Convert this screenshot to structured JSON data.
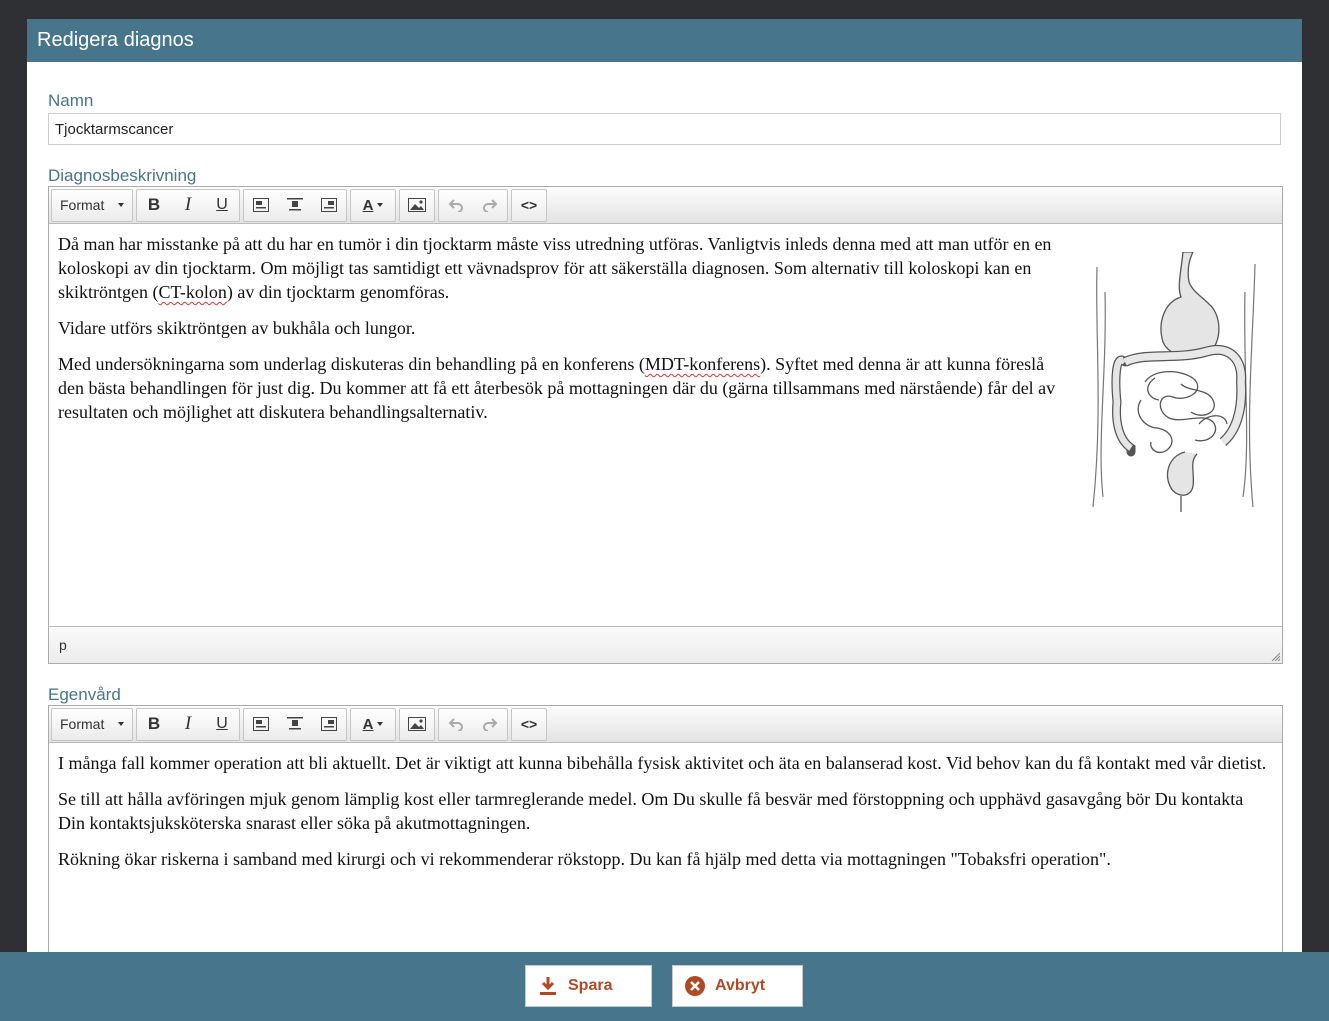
{
  "dialog": {
    "title": "Redigera diagnos"
  },
  "name_field": {
    "label": "Namn",
    "value": "Tjocktarmscancer"
  },
  "toolbar": {
    "format_label": "Format",
    "bold_label": "B",
    "italic_label": "I",
    "underline_label": "U",
    "text_color_label": "A",
    "source_label": "<>"
  },
  "description": {
    "label": "Diagnosbeskrivning",
    "p1_a": "Då man har misstanke på att du har en tumör i din tjocktarm måste viss utredning utföras. Vanligtvis inleds denna med att man utför en en koloskopi av din tjocktarm. Om möjligt tas samtidigt ett vävnadsprov för att säkerställa diagnosen. Som alternativ till koloskopi kan en skiktröntgen (",
    "p1_b": "CT-kolon",
    "p1_c": ") av din tjocktarm genomföras.",
    "p2": "Vidare utförs skiktröntgen av bukhåla och lungor.",
    "p3_a": "Med undersökningarna som underlag diskuteras din behandling på en konferens (",
    "p3_b": "MDT-konferens",
    "p3_c": "). Syftet med denna är att kunna föreslå den bästa behandlingen för just dig. Du kommer att få ett återbesök på mottagningen där du (gärna tillsammans med närstående) får del av resultaten och möjlighet att diskutera behandlingsalternativ.",
    "status_path": "p",
    "illustration": "digestive-system-illustration"
  },
  "selfcare": {
    "label": "Egenvård",
    "p1": "I många fall kommer operation att bli aktuellt. Det är viktigt att kunna bibehålla fysisk aktivitet och äta en balanserad kost. Vid behov kan du få kontakt med vår dietist.",
    "p2": "Se till att hålla avföringen mjuk genom lämplig kost eller tarmreglerande medel. Om Du skulle få besvär med förstoppning och upphävd gasavgång bör Du kontakta Din kontaktsjuksköterska snarast eller söka på akutmottagningen.",
    "p3": "Rökning ökar riskerna i samband med kirurgi och vi rekommenderar rökstopp. Du kan få hjälp med detta via mottagningen \"Tobaksfri operation\"."
  },
  "footer": {
    "save_label": "Spara",
    "cancel_label": "Avbryt"
  },
  "colors": {
    "header": "#47758c",
    "label": "#47758c",
    "button_text": "#b04a25",
    "footer": "#47758c",
    "spellcheck": "#d33333"
  },
  "icons": [
    "caret-down-icon",
    "align-left-icon",
    "align-center-icon",
    "align-right-icon",
    "image-icon",
    "undo-icon",
    "redo-icon",
    "code-icon",
    "download-icon",
    "cancel-circle-icon",
    "resize-handle-icon"
  ]
}
